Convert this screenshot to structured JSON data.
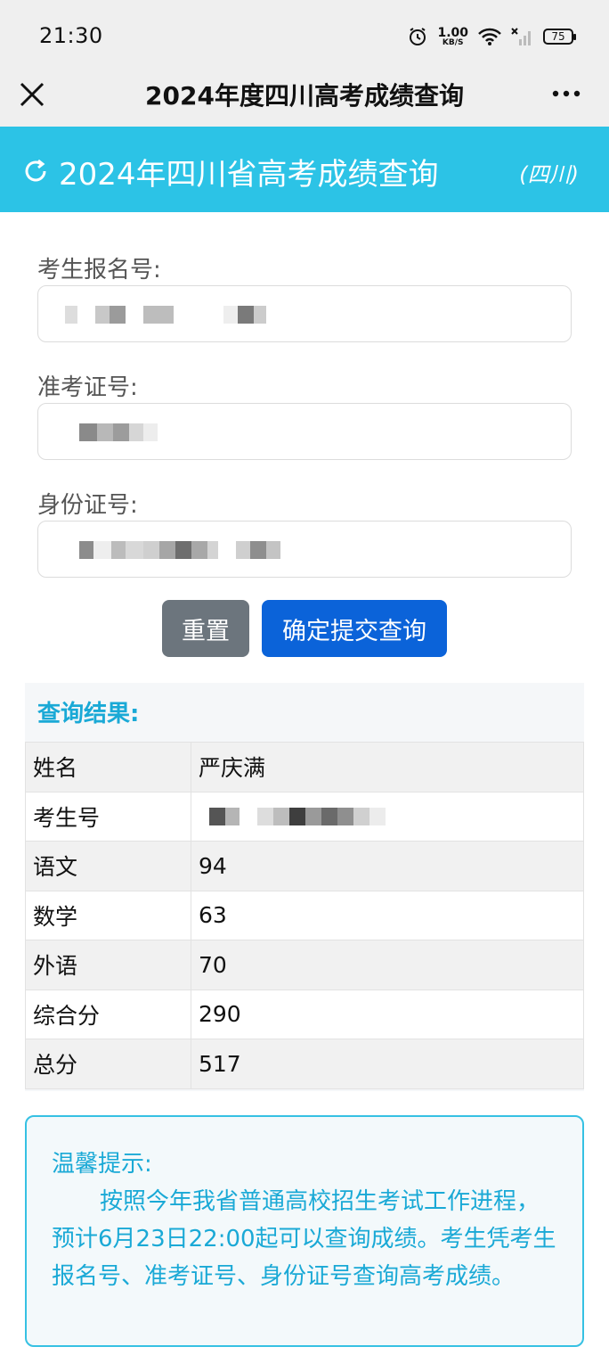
{
  "status_bar": {
    "time": "21:30",
    "net_speed": "1.00",
    "net_unit": "KB/S",
    "battery": "75",
    "icons": [
      "alarm-icon",
      "wifi-icon",
      "signal-icon",
      "battery-icon"
    ]
  },
  "title_bar": {
    "title": "2024年度四川高考成绩查询",
    "close_icon": "close-icon",
    "more_icon": "more-icon"
  },
  "header": {
    "title": "2024年四川省高考成绩查询",
    "region": "(四川)",
    "icon": "refresh-icon",
    "color": "#2cc3e6"
  },
  "form": {
    "reg_label": "考生报名号:",
    "ticket_label": "准考证号:",
    "id_label": "身份证号:",
    "reset_label": "重置",
    "submit_label": "确定提交查询"
  },
  "result": {
    "title": "查询结果:",
    "rows": [
      {
        "key": "姓名",
        "value": "严庆满"
      },
      {
        "key": "考生号",
        "value": ""
      },
      {
        "key": "语文",
        "value": "94"
      },
      {
        "key": "数学",
        "value": "63"
      },
      {
        "key": "外语",
        "value": "70"
      },
      {
        "key": "综合分",
        "value": "290"
      },
      {
        "key": "总分",
        "value": "517"
      }
    ]
  },
  "tip": {
    "title": "温馨提示:",
    "body": "按照今年我省普通高校招生考试工作进程，预计6月23日22:00起可以查询成绩。考生凭考生报名号、准考证号、身份证号查询高考成绩。"
  },
  "colors": {
    "accent": "#1aa9d6",
    "submit": "#0b63d9",
    "reset": "#6c757d"
  }
}
